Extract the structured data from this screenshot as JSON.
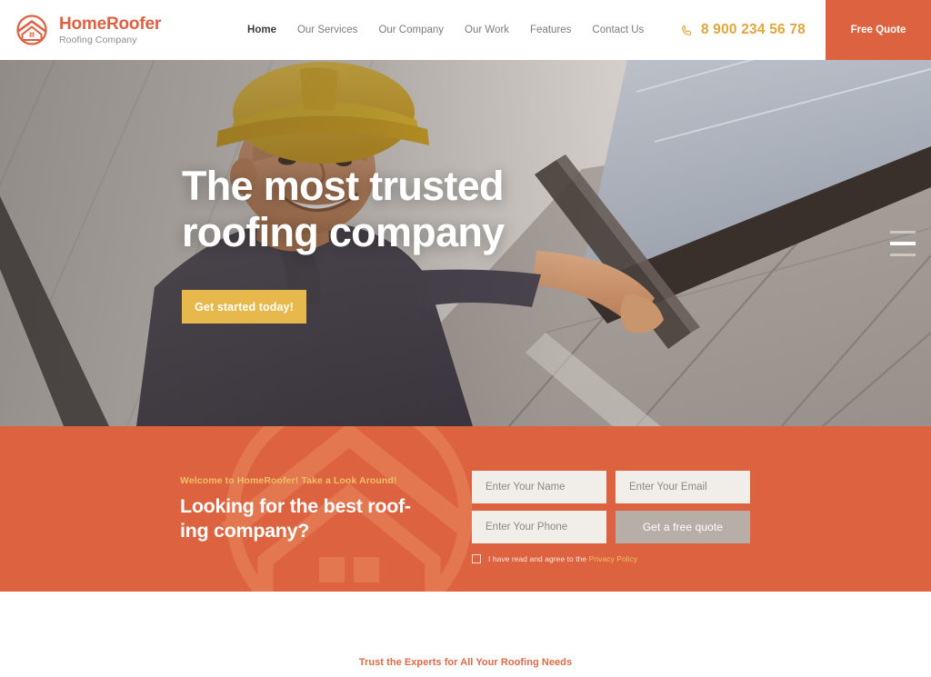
{
  "header": {
    "brand": {
      "icon": "house-circle-logo-icon",
      "name": "HomeRoofer",
      "tagline": "Roofing Company"
    },
    "nav": [
      {
        "label": "Home",
        "active": true
      },
      {
        "label": "Our Services",
        "active": false
      },
      {
        "label": "Our Company",
        "active": false
      },
      {
        "label": "Our Work",
        "active": false
      },
      {
        "label": "Features",
        "active": false
      },
      {
        "label": "Contact Us",
        "active": false
      }
    ],
    "phone": {
      "icon": "phone-icon",
      "number": "8 900 234 56 78"
    },
    "free_quote_label": "Free Quote"
  },
  "hero": {
    "title_line1": "The most trusted",
    "title_line2": "roofing company",
    "button_label": "Get started today!",
    "slides": [
      {
        "active": false
      },
      {
        "active": true
      },
      {
        "active": false
      }
    ]
  },
  "cta": {
    "eyebrow": "Welcome to HomeRoofer! Take a Look Around!",
    "heading_line1": "Looking for the best roof-",
    "heading_line2": "ing company?",
    "form": {
      "name_placeholder": "Enter Your Name",
      "name_value": "",
      "email_placeholder": "Enter Your Email",
      "email_value": "",
      "phone_placeholder": "Enter Your Phone",
      "phone_value": "",
      "submit_label": "Get a free quote",
      "consent_text": "I have read and agree to the",
      "consent_link": "Privacy Policy",
      "consent_checked": false
    }
  },
  "bottom": {
    "eyebrow": "Trust the Experts for All Your Roofing Needs"
  },
  "colors": {
    "brand_orange": "#DD6340",
    "accent_yellow": "#E7B84B",
    "phone_gold": "#E0A63C",
    "submit_grey": "#B7AEA8",
    "field_bg": "#F1EEEA"
  }
}
